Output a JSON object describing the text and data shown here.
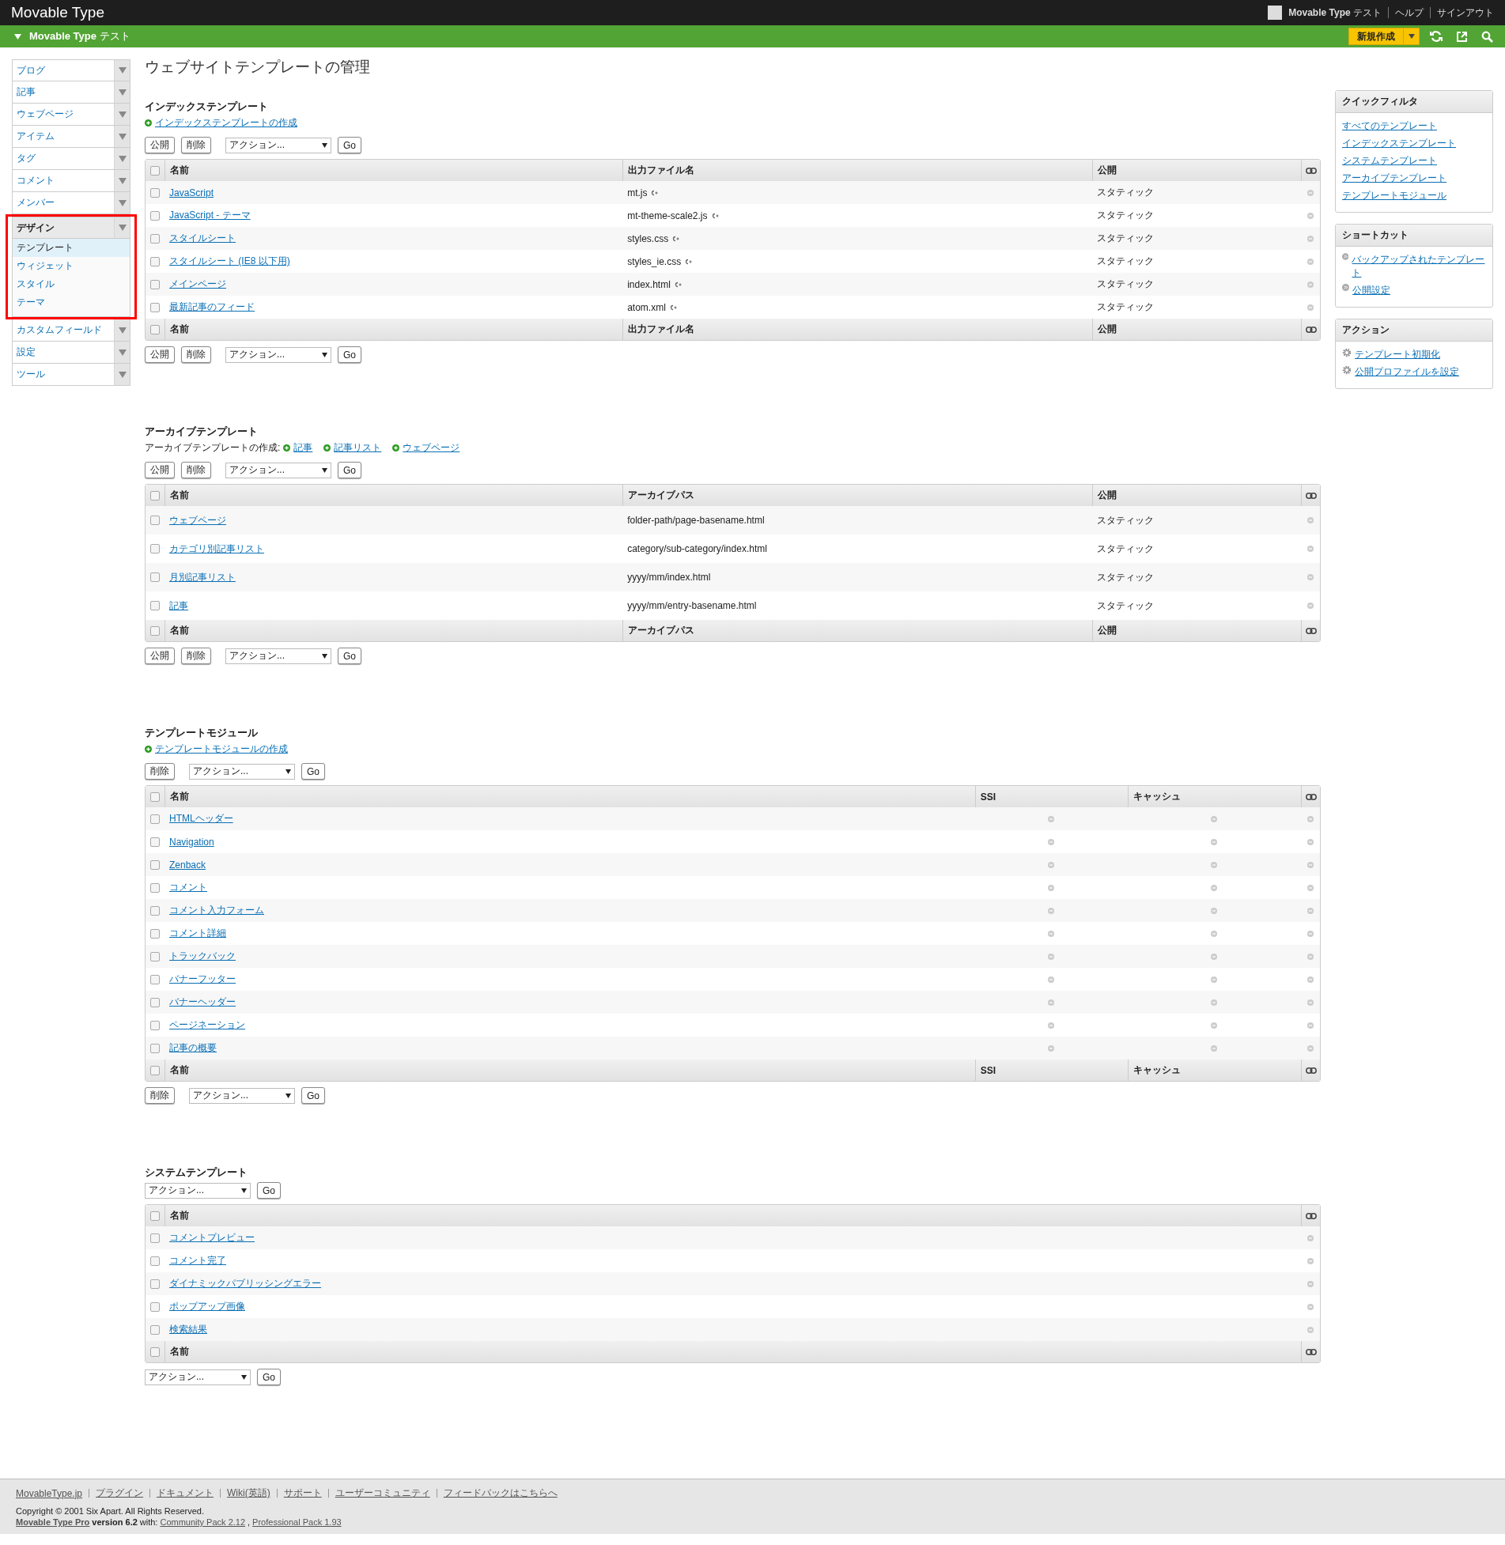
{
  "header": {
    "app_title": "Movable Type",
    "site_bold": "Movable Type",
    "site_rest": "テスト",
    "links": [
      "ヘルプ",
      "サインアウト"
    ]
  },
  "site_bar": {
    "title_bold": "Movable Type",
    "title_rest": "テスト",
    "new_button": "新規作成"
  },
  "sidebar": {
    "items": [
      {
        "label": "ブログ",
        "expanded": false
      },
      {
        "label": "記事",
        "expanded": false
      },
      {
        "label": "ウェブページ",
        "expanded": false
      },
      {
        "label": "アイテム",
        "expanded": false
      },
      {
        "label": "タグ",
        "expanded": false
      },
      {
        "label": "コメント",
        "expanded": false
      },
      {
        "label": "メンバー",
        "expanded": false
      },
      {
        "label": "デザイン",
        "expanded": true,
        "children": [
          {
            "label": "テンプレート",
            "selected": true
          },
          {
            "label": "ウィジェット",
            "selected": false
          },
          {
            "label": "スタイル",
            "selected": false
          },
          {
            "label": "テーマ",
            "selected": false
          }
        ]
      },
      {
        "label": "カスタムフィールド",
        "expanded": false
      },
      {
        "label": "設定",
        "expanded": false
      },
      {
        "label": "ツール",
        "expanded": false
      }
    ]
  },
  "page_title": "ウェブサイトテンプレートの管理",
  "sections": [
    {
      "kind": "index",
      "title": "インデックステンプレート",
      "create_links": [
        "インデックステンプレートの作成"
      ],
      "top_bar": {
        "buttons": [
          "公開",
          "削除"
        ],
        "action": "アクション...",
        "go": "Go"
      },
      "columns": [
        {
          "label": "名前",
          "kind": "name"
        },
        {
          "label": "出力ファイル名",
          "kind": "file"
        },
        {
          "label": "公開",
          "kind": "publish"
        }
      ],
      "header_checked": false,
      "rows": [
        {
          "checked": false,
          "name": "JavaScript",
          "output": "mt.js",
          "publish": "スタティック"
        },
        {
          "checked": false,
          "name": "JavaScript - テーマ",
          "output": "mt-theme-scale2.js",
          "publish": "スタティック"
        },
        {
          "checked": false,
          "name": "スタイルシート",
          "output": "styles.css",
          "publish": "スタティック"
        },
        {
          "checked": false,
          "name": "スタイルシート (IE8 以下用)",
          "output": "styles_ie.css",
          "publish": "スタティック"
        },
        {
          "checked": false,
          "name": "メインページ",
          "output": "index.html",
          "publish": "スタティック"
        },
        {
          "checked": false,
          "name": "最新記事のフィード",
          "output": "atom.xml",
          "publish": "スタティック"
        }
      ],
      "footer_columns": [
        "名前",
        "出力ファイル名",
        "公開"
      ],
      "footer_checked": false,
      "bottom_bar": {
        "buttons": [
          "公開",
          "削除"
        ],
        "action": "アクション...",
        "go": "Go"
      }
    },
    {
      "kind": "archive",
      "title": "アーカイブテンプレート",
      "create_prefix": "アーカイブテンプレートの作成:",
      "create_links": [
        "記事",
        "記事リスト",
        "ウェブページ"
      ],
      "top_bar": {
        "buttons": [
          "公開",
          "削除"
        ],
        "action": "アクション...",
        "go": "Go"
      },
      "columns": [
        {
          "label": "名前",
          "kind": "name"
        },
        {
          "label": "アーカイブパス",
          "kind": "path"
        },
        {
          "label": "公開",
          "kind": "publish"
        }
      ],
      "header_checked": false,
      "rows": [
        {
          "checked": false,
          "name": "ウェブページ",
          "output": "folder-path/page-basename.html",
          "publish": "スタティック"
        },
        {
          "checked": false,
          "name": "カテゴリ別記事リスト",
          "output": "category/sub-category/index.html",
          "publish": "スタティック"
        },
        {
          "checked": false,
          "name": "月別記事リスト",
          "output": "yyyy/mm/index.html",
          "publish": "スタティック"
        },
        {
          "checked": false,
          "name": "記事",
          "output": "yyyy/mm/entry-basename.html",
          "publish": "スタティック"
        }
      ],
      "footer_columns": [
        "名前",
        "アーカイブパス",
        "公開"
      ],
      "footer_checked": false,
      "bottom_bar": {
        "buttons": [
          "公開",
          "削除"
        ],
        "action": "アクション...",
        "go": "Go"
      }
    },
    {
      "kind": "module",
      "title": "テンプレートモジュール",
      "create_links": [
        "テンプレートモジュールの作成"
      ],
      "top_bar": {
        "buttons": [
          "削除"
        ],
        "action": "アクション...",
        "go": "Go"
      },
      "columns": [
        {
          "label": "名前",
          "kind": "name"
        },
        {
          "label": "SSI",
          "kind": "dot"
        },
        {
          "label": "キャッシュ",
          "kind": "dot"
        }
      ],
      "header_checked": false,
      "rows": [
        {
          "checked": false,
          "name": "HTMLヘッダー"
        },
        {
          "checked": false,
          "name": "Navigation"
        },
        {
          "checked": false,
          "name": "Zenback"
        },
        {
          "checked": false,
          "name": "コメント"
        },
        {
          "checked": false,
          "name": "コメント入力フォーム"
        },
        {
          "checked": false,
          "name": "コメント詳細"
        },
        {
          "checked": false,
          "name": "トラックバック"
        },
        {
          "checked": false,
          "name": "バナーフッター"
        },
        {
          "checked": false,
          "name": "バナーヘッダー"
        },
        {
          "checked": false,
          "name": "ページネーション"
        },
        {
          "checked": false,
          "name": "記事の概要"
        }
      ],
      "footer_columns": [
        "名前",
        "SSI",
        "キャッシュ"
      ],
      "footer_checked": false,
      "bottom_bar": {
        "buttons": [
          "削除"
        ],
        "action": "アクション...",
        "go": "Go"
      }
    },
    {
      "kind": "system",
      "title": "システムテンプレート",
      "top_bar": {
        "action": "アクション...",
        "go": "Go"
      },
      "columns": [
        {
          "label": "名前",
          "kind": "name"
        }
      ],
      "header_checked": false,
      "rows": [
        {
          "checked": false,
          "name": "コメントプレビュー"
        },
        {
          "checked": false,
          "name": "コメント完了"
        },
        {
          "checked": false,
          "name": "ダイナミックパブリッシングエラー"
        },
        {
          "checked": false,
          "name": "ポップアップ画像"
        },
        {
          "checked": false,
          "name": "検索結果"
        }
      ],
      "footer_columns": [
        "名前"
      ],
      "footer_checked": false,
      "bottom_bar": {
        "action": "アクション...",
        "go": "Go"
      }
    }
  ],
  "right_panel": [
    {
      "kind": "filter",
      "title": "クイックフィルタ",
      "links": [
        "すべてのテンプレート",
        "インデックステンプレート",
        "システムテンプレート",
        "アーカイブテンプレート",
        "テンプレートモジュール"
      ]
    },
    {
      "kind": "shortcut",
      "title": "ショートカット",
      "links": [
        "バックアップされたテンプレート",
        "公開設定"
      ]
    },
    {
      "kind": "action",
      "title": "アクション",
      "links": [
        "テンプレート初期化",
        "公開プロファイルを設定"
      ]
    }
  ],
  "footer": {
    "links": [
      "MovableType.jp",
      "プラグイン",
      "ドキュメント",
      "Wiki(英語)",
      "サポート",
      "ユーザーコミュニティ",
      "フィードバックはこちらへ"
    ],
    "copyright": "Copyright © 2001 Six Apart. All Rights Reserved.",
    "product": "Movable Type Pro",
    "version": "version 6.2",
    "with": "with:",
    "packs": [
      "Community Pack 2.12",
      "Professional Pack 1.93"
    ],
    "separator": ","
  }
}
